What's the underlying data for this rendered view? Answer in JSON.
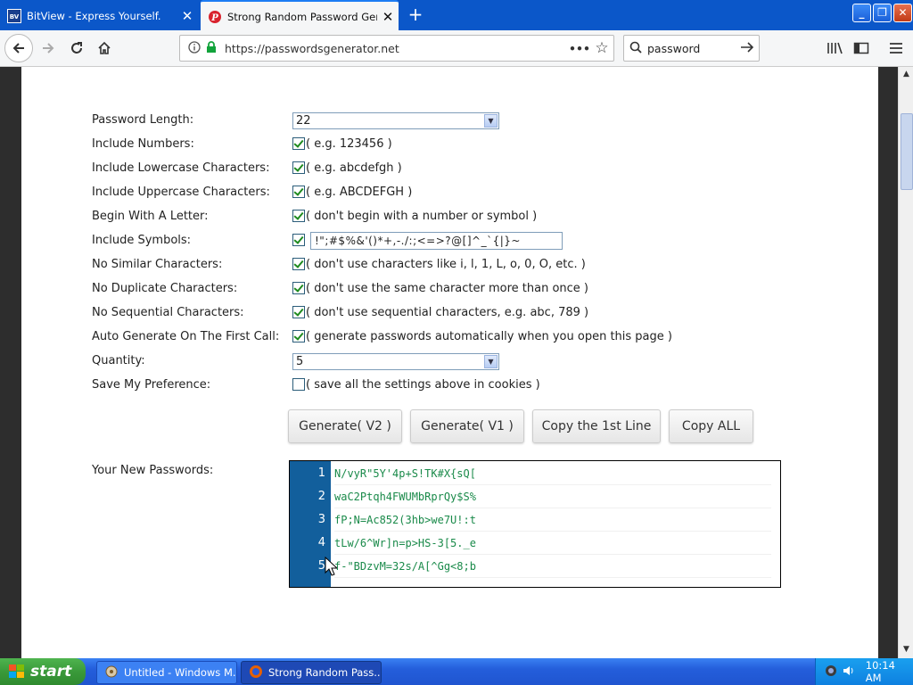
{
  "browser": {
    "tabs": [
      {
        "title": "BitView - Express Yourself.",
        "active": false,
        "icon": "bitview-icon"
      },
      {
        "title": "Strong Random Password Genera",
        "active": true,
        "icon": "passwordsgenerator-icon"
      }
    ],
    "url": "https://passwordsgenerator.net",
    "search_value": "password"
  },
  "form": {
    "password_length": {
      "label": "Password Length:",
      "value": "22"
    },
    "include_numbers": {
      "label": "Include Numbers:",
      "checked": true,
      "hint": "( e.g. 123456 )"
    },
    "include_lowercase": {
      "label": "Include Lowercase Characters:",
      "checked": true,
      "hint": "( e.g. abcdefgh )"
    },
    "include_uppercase": {
      "label": "Include Uppercase Characters:",
      "checked": true,
      "hint": "( e.g. ABCDEFGH )"
    },
    "begin_with_letter": {
      "label": "Begin With A Letter:",
      "checked": true,
      "hint": "( don't begin with a number or symbol )"
    },
    "include_symbols": {
      "label": "Include Symbols:",
      "checked": true,
      "value": "!\";#$%&'()*+,-./:;<=>?@[]^_`{|}~"
    },
    "no_similar": {
      "label": "No Similar Characters:",
      "checked": true,
      "hint": "( don't use characters like i, l, 1, L, o, 0, O, etc. )"
    },
    "no_duplicate": {
      "label": "No Duplicate Characters:",
      "checked": true,
      "hint": "( don't use the same character more than once )"
    },
    "no_sequential": {
      "label": "No Sequential Characters:",
      "checked": true,
      "hint": "( don't use sequential characters, e.g. abc, 789 )"
    },
    "auto_generate": {
      "label": "Auto Generate On The First Call:",
      "checked": true,
      "hint": "( generate passwords automatically when you open this page )"
    },
    "quantity": {
      "label": "Quantity:",
      "value": "5"
    },
    "save_preference": {
      "label": "Save My Preference:",
      "checked": false,
      "hint": "( save all the settings above in cookies )"
    }
  },
  "buttons": {
    "generate_v2": "Generate( V2 )",
    "generate_v1": "Generate( V1 )",
    "copy_first": "Copy the 1st Line",
    "copy_all": "Copy ALL"
  },
  "results": {
    "label": "Your New Passwords:",
    "lines": [
      {
        "n": "1",
        "pw": "N/vyR\"5Y'4p+S!TK#X{sQ["
      },
      {
        "n": "2",
        "pw": "waC2Ptqh4FWUMbRprQy$S%"
      },
      {
        "n": "3",
        "pw": "fP;N=Ac852(3hb>we7U!:t"
      },
      {
        "n": "4",
        "pw": "tLw/6^Wr]n=p>HS-3[5._e"
      },
      {
        "n": "5",
        "pw": "f-\"BDzvM=32s/A[^Gg<8;b"
      }
    ]
  },
  "taskbar": {
    "start": "start",
    "tasks": [
      "Untitled - Windows M...",
      "Strong Random Pass..."
    ],
    "clock": "10:14 AM"
  }
}
